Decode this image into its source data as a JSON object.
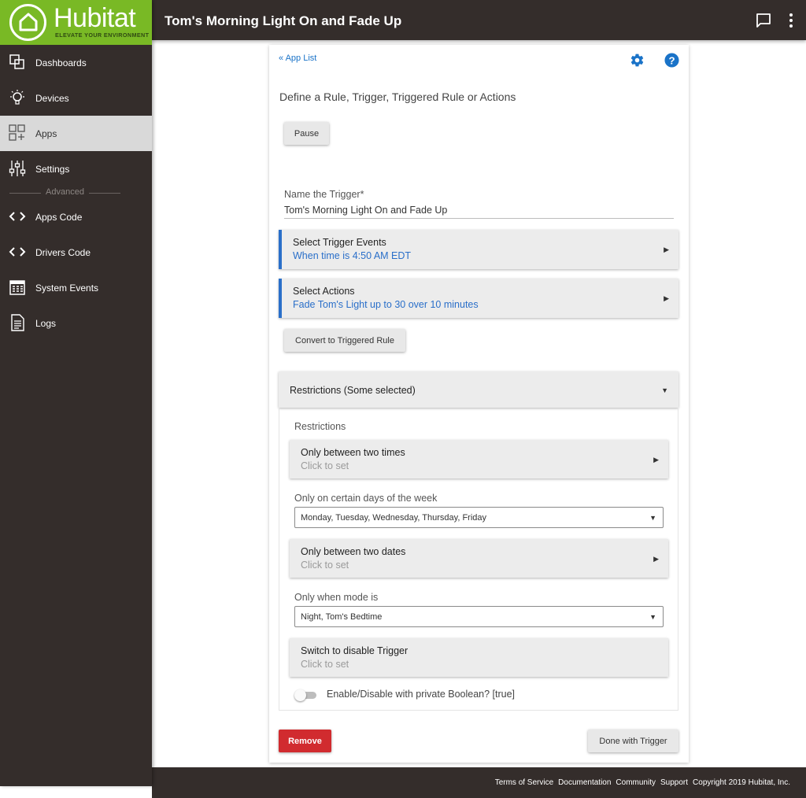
{
  "brand": {
    "name": "Hubitat",
    "tagline": "ELEVATE YOUR ENVIRONMENT",
    "accent": "#79b925"
  },
  "sidebar": {
    "items": [
      {
        "label": "Dashboards",
        "icon": "dashboards-icon"
      },
      {
        "label": "Devices",
        "icon": "bulb-icon"
      },
      {
        "label": "Apps",
        "icon": "apps-icon",
        "active": true
      },
      {
        "label": "Settings",
        "icon": "sliders-icon"
      }
    ],
    "advanced_label": "Advanced",
    "advanced_items": [
      {
        "label": "Apps Code",
        "icon": "code-icon"
      },
      {
        "label": "Drivers Code",
        "icon": "code-icon"
      },
      {
        "label": "System Events",
        "icon": "calendar-icon"
      },
      {
        "label": "Logs",
        "icon": "document-icon"
      }
    ]
  },
  "topbar": {
    "title": "Tom's Morning Light On and Fade Up"
  },
  "page": {
    "app_list_link": "« App List",
    "heading": "Define a Rule, Trigger, Triggered Rule or Actions",
    "pause_label": "Pause",
    "name_label": "Name the Trigger*",
    "name_value": "Tom's Morning Light On and Fade Up",
    "trigger_events": {
      "title": "Select Trigger Events",
      "value": "When time is 4:50 AM EDT"
    },
    "actions": {
      "title": "Select Actions",
      "value": "Fade Tom's Light up to 30 over 10 minutes"
    },
    "convert_label": "Convert to Triggered Rule",
    "restrictions": {
      "header": "Restrictions (Some selected)",
      "label": "Restrictions",
      "between_times": {
        "title": "Only between two times",
        "value": "Click to set"
      },
      "days_label": "Only on certain days of the week",
      "days_value": "Monday, Tuesday, Wednesday, Thursday, Friday",
      "between_dates": {
        "title": "Only between two dates",
        "value": "Click to set"
      },
      "mode_label": "Only when mode is",
      "mode_value": "Night, Tom's Bedtime",
      "switch_disable": {
        "title": "Switch to disable Trigger",
        "value": "Click to set"
      },
      "boolean_label": "Enable/Disable with private Boolean? [true]",
      "boolean_on": false
    },
    "remove_label": "Remove",
    "done_label": "Done with Trigger"
  },
  "footer": {
    "links": [
      "Terms of Service",
      "Documentation",
      "Community",
      "Support"
    ],
    "copyright": "Copyright 2019 Hubitat, Inc."
  },
  "colors": {
    "dark": "#342d2b",
    "link_blue": "#1a73c8",
    "value_blue": "#2a6fc9",
    "remove_red": "#d12b2f"
  }
}
